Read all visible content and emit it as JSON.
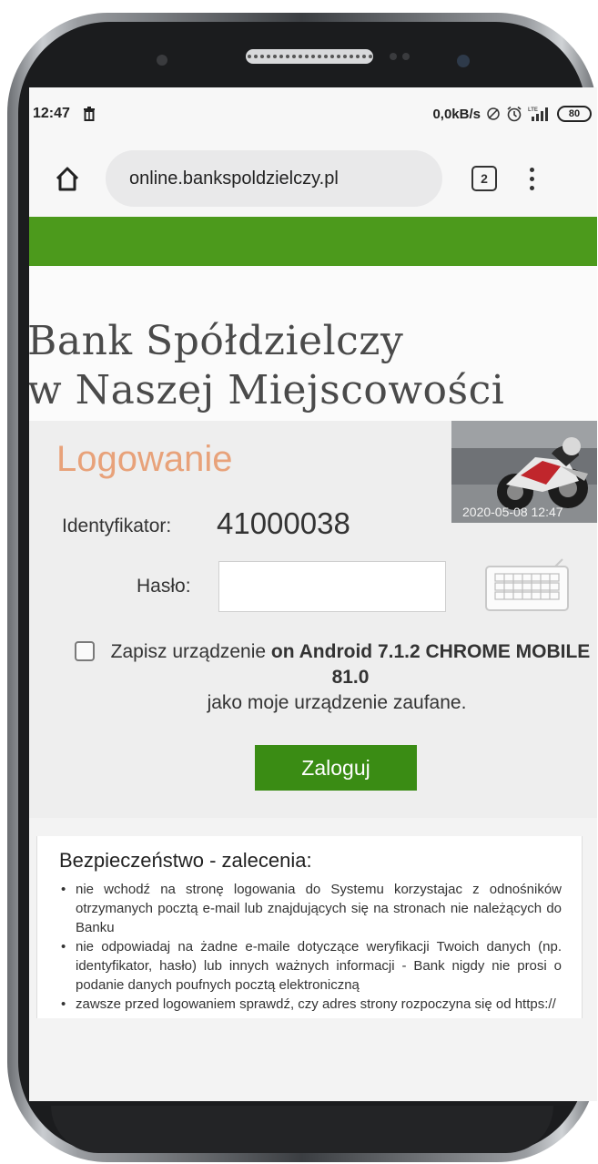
{
  "status_bar": {
    "time": "12:47",
    "network_speed": "0,0kB/s",
    "battery": "80"
  },
  "browser": {
    "url": "online.bankspoldzielczy.pl",
    "tab_count": "2"
  },
  "site": {
    "title_line1": "Bank Spółdzielczy",
    "title_line2": "w Naszej Miejscowości"
  },
  "login": {
    "heading": "Logowanie",
    "photo_timestamp": "2020-05-08 12:47",
    "id_label": "Identyfikator:",
    "id_value": "41000038",
    "password_label": "Hasło:",
    "password_value": "",
    "remember_prefix": "Zapisz urządzenie ",
    "remember_device": "on Android 7.1.2 CHROME MOBILE 81.0",
    "remember_suffix": "jako moje urządzenie zaufane.",
    "submit_label": "Zaloguj"
  },
  "security": {
    "title": "Bezpieczeństwo - zalecenia:",
    "items": [
      "nie wchodź na stronę logowania do Systemu korzystajac z odnośników otrzymanych pocztą e-mail lub znajdujących się na stronach nie należących do Banku",
      "nie odpowiadaj na żadne e-maile dotyczące weryfikacji Twoich danych (np. identyfikator, hasło) lub innych ważnych informacji - Bank nigdy nie prosi o podanie danych poufnych pocztą elektroniczną",
      "zawsze przed logowaniem sprawdź, czy adres strony rozpoczyna się od https://"
    ]
  },
  "colors": {
    "brand_green": "#4c9a1c",
    "button_green": "#3a8c14",
    "login_heading": "#e8a27a"
  }
}
